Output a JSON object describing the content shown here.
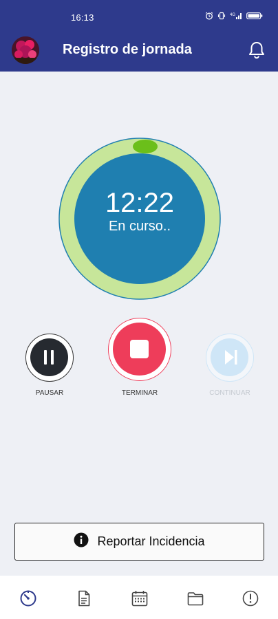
{
  "status_bar": {
    "time": "16:13",
    "icons": [
      "alarm-icon",
      "vibrate-icon",
      "signal-icon",
      "battery-icon"
    ]
  },
  "header": {
    "title": "Registro de jornada",
    "avatar": "avatar",
    "notification_icon": "bell-icon",
    "background": "#2e3a8c"
  },
  "timer": {
    "time": "12:22",
    "status": "En curso..",
    "ring_color": "#c7e69a",
    "fill_color": "#1f7fb0",
    "indicator_color": "#6bbf1a"
  },
  "controls": {
    "pause": {
      "label": "PAUSAR",
      "enabled": true
    },
    "stop": {
      "label": "TERMINAR",
      "enabled": true,
      "color": "#ee3d5a"
    },
    "resume": {
      "label": "CONTINUAR",
      "enabled": false
    }
  },
  "report_button": {
    "label": "Reportar Incidencia",
    "icon": "info-icon"
  },
  "bottom_nav": {
    "items": [
      {
        "icon": "timer-icon",
        "active": true
      },
      {
        "icon": "document-icon",
        "active": false
      },
      {
        "icon": "calendar-icon",
        "active": false
      },
      {
        "icon": "folder-icon",
        "active": false
      },
      {
        "icon": "info-circle-icon",
        "active": false
      }
    ],
    "active_color": "#2e3a8c"
  }
}
